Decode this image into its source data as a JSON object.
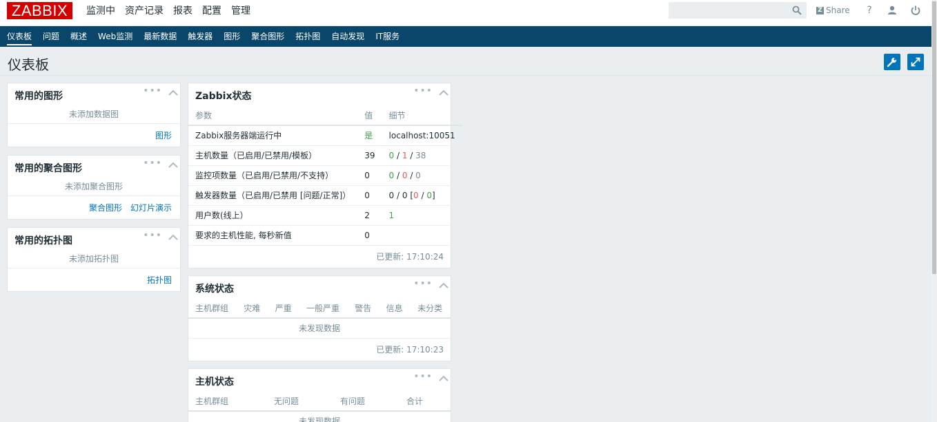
{
  "header": {
    "logo": "ZABBIX",
    "nav": [
      "监测中",
      "资产记录",
      "报表",
      "配置",
      "管理"
    ],
    "search_value": "",
    "share": "Share",
    "help": "?"
  },
  "subnav": [
    "仪表板",
    "问题",
    "概述",
    "Web监测",
    "最新数据",
    "触发器",
    "图形",
    "聚合图形",
    "拓扑图",
    "自动发现",
    "IT服务"
  ],
  "page": {
    "title": "仪表板"
  },
  "fav_graphs": {
    "title": "常用的图形",
    "dots": "•••",
    "empty": "未添加数据图",
    "link": "图形"
  },
  "fav_screens": {
    "title": "常用的聚合图形",
    "dots": "•••",
    "empty": "未添加聚合图形",
    "links": [
      "聚合图形",
      "幻灯片演示"
    ]
  },
  "fav_maps": {
    "title": "常用的拓扑图",
    "dots": "•••",
    "empty": "未添加拓扑图",
    "link": "拓扑图"
  },
  "zabbix_status": {
    "title": "Zabbix状态",
    "dots": "•••",
    "columns": [
      "参数",
      "值",
      "细节"
    ],
    "rows": [
      {
        "param": "Zabbix服务器端运行中",
        "value": "是",
        "details": "localhost:10051"
      },
      {
        "param": "主机数量（已启用/已禁用/模板）",
        "value": "39",
        "d1": "0",
        "d2": "1",
        "d3": "38"
      },
      {
        "param": "监控项数量（已启用/已禁用/不支持）",
        "value": "0",
        "d1": "0",
        "d2": "0",
        "d3": "0"
      },
      {
        "param": "触发器数量（已启用/已禁用 [问题/正常]）",
        "value": "0",
        "d1": "0",
        "d2": "0",
        "d3": "0",
        "d4": "0"
      },
      {
        "param": "用户数(线上）",
        "value": "2",
        "details": "1"
      },
      {
        "param": "要求的主机性能, 每秒新值",
        "value": "0",
        "details": ""
      }
    ],
    "updated": "已更新: 17:10:24"
  },
  "system_status": {
    "title": "系统状态",
    "dots": "•••",
    "columns": [
      "主机群组",
      "灾难",
      "严重",
      "一般严重",
      "警告",
      "信息",
      "未分类"
    ],
    "empty": "未发现数据",
    "updated": "已更新: 17:10:23"
  },
  "host_status": {
    "title": "主机状态",
    "dots": "•••",
    "columns": [
      "主机群组",
      "无问题",
      "有问题",
      "合计"
    ],
    "empty": "未发现数据"
  },
  "colors": {
    "brand": "#d40000",
    "subnav": "#0a466a",
    "accent": "#0275b8",
    "ok": "#429e47",
    "problem": "#e45959"
  }
}
